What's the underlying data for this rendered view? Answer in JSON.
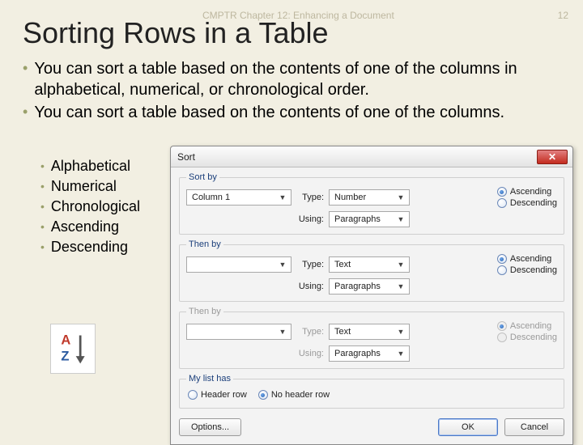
{
  "header": {
    "chapter": "CMPTR Chapter 12: Enhancing a Document",
    "page_number": "12"
  },
  "title": "Sorting Rows in a Table",
  "bullets": [
    "You can sort a table based on the contents of one of the columns in alphabetical, numerical, or chronological order.",
    "You can sort a table based on the contents of one of the columns."
  ],
  "sub_bullets": [
    "Alphabetical",
    "Numerical",
    "Chronological",
    "Ascending",
    "Descending"
  ],
  "dialog": {
    "title": "Sort",
    "sort_by": {
      "legend": "Sort by",
      "column": "Column 1",
      "type_label": "Type:",
      "type_value": "Number",
      "using_label": "Using:",
      "using_value": "Paragraphs",
      "ascending": "Ascending",
      "descending": "Descending",
      "selected": "ascending"
    },
    "then_by_1": {
      "legend": "Then by",
      "column": "",
      "type_label": "Type:",
      "type_value": "Text",
      "using_label": "Using:",
      "using_value": "Paragraphs",
      "ascending": "Ascending",
      "descending": "Descending",
      "selected": "ascending"
    },
    "then_by_2": {
      "legend": "Then by",
      "column": "",
      "type_label": "Type:",
      "type_value": "Text",
      "using_label": "Using:",
      "using_value": "Paragraphs",
      "ascending": "Ascending",
      "descending": "Descending",
      "selected": "ascending"
    },
    "my_list": {
      "legend": "My list has",
      "header_row": "Header row",
      "no_header_row": "No header row",
      "selected": "no_header_row"
    },
    "buttons": {
      "options": "Options...",
      "ok": "OK",
      "cancel": "Cancel"
    }
  }
}
